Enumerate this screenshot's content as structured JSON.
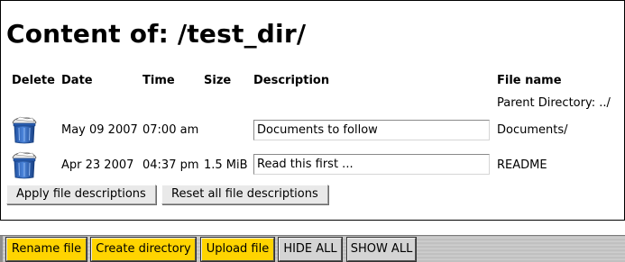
{
  "page": {
    "title": "Content of: /test_dir/"
  },
  "table": {
    "headers": {
      "delete": "Delete",
      "date": "Date",
      "time": "Time",
      "size": "Size",
      "description": "Description",
      "filename": "File name"
    },
    "parent_link": "Parent Directory: ../",
    "rows": [
      {
        "date": "May 09 2007",
        "time": "07:00 am",
        "size": "",
        "description": "Documents to follow",
        "filename": "Documents/"
      },
      {
        "date": "Apr 23 2007",
        "time": "04:37 pm",
        "size": "1.5 MiB",
        "description": "Read this first ...",
        "filename": "README"
      }
    ]
  },
  "actions": {
    "apply": "Apply file descriptions",
    "reset": "Reset all file descriptions"
  },
  "toolbar": {
    "rename": "Rename file",
    "create_dir": "Create directory",
    "upload": "Upload file",
    "hide_all": "HIDE ALL",
    "show_all": "SHOW ALL",
    "colors": {
      "primary": "#ffd400",
      "secondary": "#d4d4d4"
    }
  },
  "icons": {
    "delete": "trash-can-icon"
  }
}
